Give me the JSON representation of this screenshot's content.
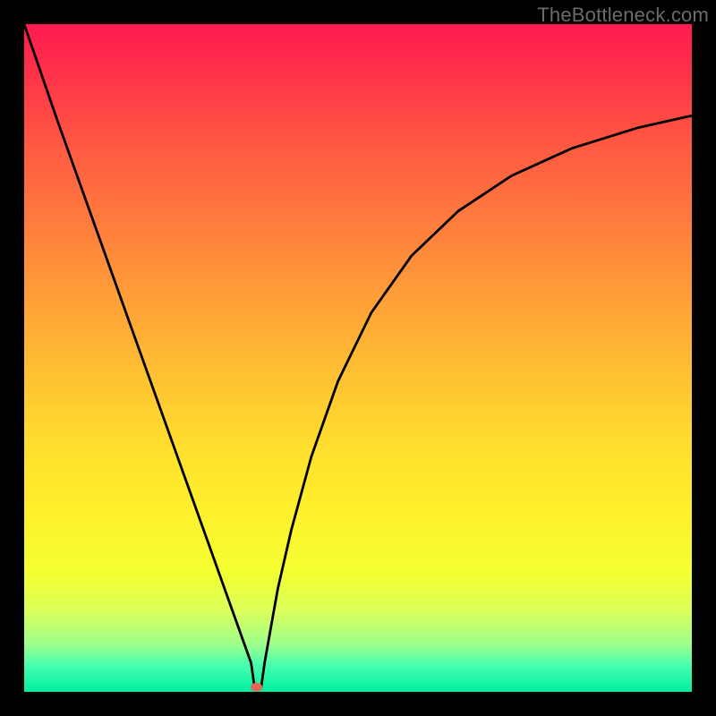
{
  "watermark": {
    "text": "TheBottleneck.com"
  },
  "chart_data": {
    "type": "line",
    "title": "",
    "subtitle": "",
    "xlabel": "",
    "ylabel": "",
    "xlim": [
      0,
      100
    ],
    "ylim": [
      0,
      100
    ],
    "grid": false,
    "legend": {
      "position": "none"
    },
    "marker": {
      "x_pct": 34.8,
      "y_pct": 0.7,
      "color": "#e26a5a"
    },
    "series": [
      {
        "name": "curve",
        "color": "#000000",
        "x_pct": [
          0,
          5,
          10,
          15,
          20,
          25,
          28,
          30,
          32,
          33.5,
          34,
          34.5,
          35.5,
          36,
          37,
          38,
          40,
          43,
          47,
          52,
          58,
          65,
          73,
          82,
          92,
          100
        ],
        "y_pct": [
          100,
          85.5,
          71.5,
          57.5,
          43.5,
          29.5,
          21.1,
          15.5,
          9.9,
          5.7,
          4.3,
          0.7,
          0.7,
          4.3,
          9.9,
          15.5,
          24.2,
          35.2,
          46.5,
          56.8,
          65.3,
          72.0,
          77.3,
          81.4,
          84.5,
          86.3
        ]
      }
    ]
  }
}
